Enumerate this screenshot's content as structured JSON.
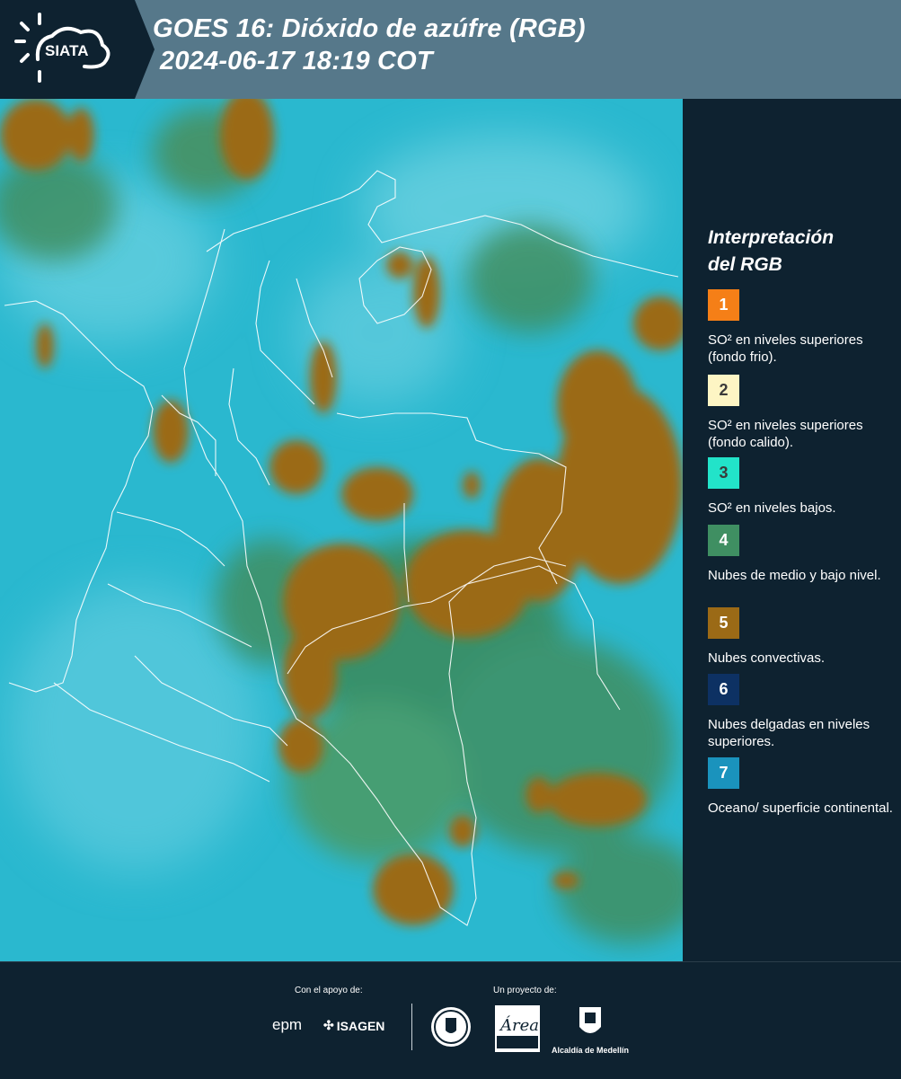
{
  "header": {
    "logo_text": "SIATA",
    "title_line1": "GOES 16: Dióxido de azúfre (RGB)",
    "title_line2": "2024-06-17 18:19 COT"
  },
  "legend": {
    "title_line1": "Interpretación",
    "title_line2": "del RGB",
    "items": [
      {
        "number": "1",
        "color": "#f57f17",
        "text": "SO² en niveles superiores (fondo frio)."
      },
      {
        "number": "2",
        "color": "#fdf5c4",
        "text": "SO² en niveles superiores (fondo calido)."
      },
      {
        "number": "3",
        "color": "#22e3c9",
        "text": "SO² en niveles bajos."
      },
      {
        "number": "4",
        "color": "#3f8f62",
        "text": "Nubes de medio y bajo nivel."
      },
      {
        "number": "5",
        "color": "#9b6a16",
        "text": "Nubes convectivas."
      },
      {
        "number": "6",
        "color": "#0d3163",
        "text": "Nubes delgadas en niveles superiores."
      },
      {
        "number": "7",
        "color": "#1a93bd",
        "text": "Oceano/ superficie continental."
      }
    ]
  },
  "footer": {
    "support_label": "Con el apoyo de:",
    "project_label": "Un proyecto de:",
    "sponsors": [
      "epm",
      "ISAGEN"
    ],
    "partners": [
      "Área Metropolitana Valle de Aburrá",
      "Alcaldía de Medellín"
    ]
  },
  "colors": {
    "background": "#0e2230",
    "header": "#56788a",
    "sky": "#2ab8cf",
    "cloud_convective": "#9b6a16",
    "cloud_low": "#3f8f62"
  }
}
